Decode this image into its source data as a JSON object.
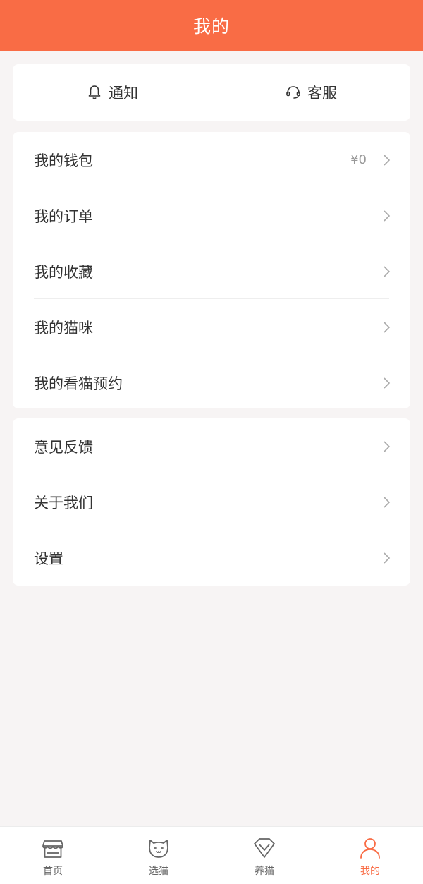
{
  "header": {
    "title": "我的"
  },
  "quick_actions": [
    {
      "label": "通知",
      "icon": "bell-icon"
    },
    {
      "label": "客服",
      "icon": "headset-icon"
    }
  ],
  "group1": [
    {
      "label": "我的钱包",
      "value": "¥0"
    },
    {
      "label": "我的订单"
    },
    {
      "label": "我的收藏"
    },
    {
      "label": "我的猫咪"
    },
    {
      "label": "我的看猫预约"
    }
  ],
  "group2": [
    {
      "label": "意见反馈"
    },
    {
      "label": "关于我们"
    },
    {
      "label": "设置"
    }
  ],
  "tabbar": {
    "active_color": "#f96c45",
    "items": [
      {
        "label": "首页",
        "icon": "shop-icon"
      },
      {
        "label": "选猫",
        "icon": "cat-face-icon"
      },
      {
        "label": "养猫",
        "icon": "diamond-icon"
      },
      {
        "label": "我的",
        "icon": "person-icon",
        "active": true
      }
    ]
  }
}
